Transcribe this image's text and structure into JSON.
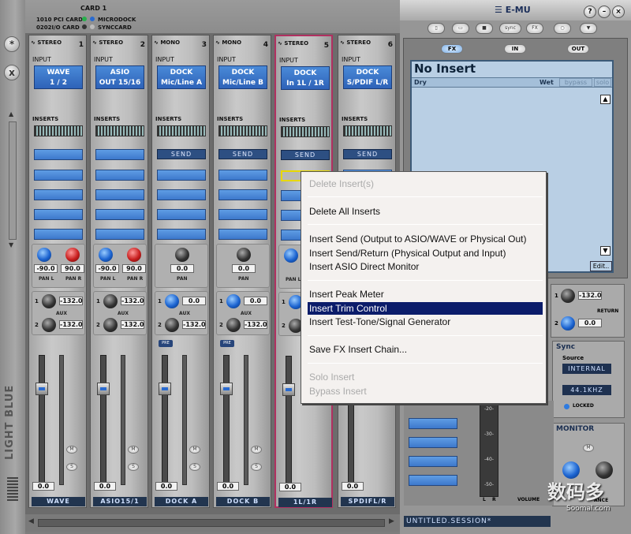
{
  "window": {
    "brand": "E-MU"
  },
  "card": {
    "title": "CARD 1",
    "line1": "1010 PCI CARD",
    "line2": "0202I/O CARD",
    "microdock": "MICRODOCK",
    "synccard": "SYNCCARD"
  },
  "sidebar": {
    "theme": "LIGHT BLUE",
    "btn1": "*",
    "btn2": "x"
  },
  "labels": {
    "input": "INPUT",
    "inserts": "INSERTS",
    "send": "SEND",
    "pan": "PAN",
    "pan_l": "PAN L",
    "pan_r": "PAN R",
    "aux": "AUX",
    "pre": "PRE",
    "m": "M",
    "s": "S"
  },
  "strips": [
    {
      "mode": "STEREO",
      "num": "1",
      "input": "WAVE\n1 / 2",
      "pan_l": "-90.0",
      "pan_r": "90.0",
      "aux1": "-132.0",
      "aux2": "-132.0",
      "fader": "0.0",
      "name": "WAVE"
    },
    {
      "mode": "STEREO",
      "num": "2",
      "input": "ASIO\nOUT 15/16",
      "pan_l": "-90.0",
      "pan_r": "90.0",
      "aux1": "-132.0",
      "aux2": "-132.0",
      "fader": "0.0",
      "name": "ASIO15/1"
    },
    {
      "mode": "MONO",
      "num": "3",
      "input": "DOCK\nMic/Line A",
      "pan": "0.0",
      "aux1": "0.0",
      "aux2": "-132.0",
      "fader": "0.0",
      "name": "DOCK A"
    },
    {
      "mode": "MONO",
      "num": "4",
      "input": "DOCK\nMic/Line B",
      "pan": "0.0",
      "aux1": "0.0",
      "aux2": "-132.0",
      "fader": "0.0",
      "name": "DOCK B"
    },
    {
      "mode": "STEREO",
      "num": "5",
      "input": "DOCK\nIn 1L / 1R",
      "fader": "0.0",
      "name": "1L/1R"
    },
    {
      "mode": "STEREO",
      "num": "6",
      "input": "DOCK\nS/PDIF L/R",
      "fader": "0.0",
      "name": "SPDIFL/R"
    }
  ],
  "toolbar": {
    "sync": "sync",
    "fx": "FX"
  },
  "fx_tabs": [
    "FX",
    "IN",
    "OUT"
  ],
  "fx_panel": {
    "title": "No Insert",
    "dry": "Dry",
    "wet": "Wet",
    "bypass": "bypass",
    "solo": "solo",
    "edit": "Edit.."
  },
  "context_menu": {
    "items": [
      {
        "label": "Delete Insert(s)",
        "enabled": false
      },
      {
        "label": "Delete All Inserts",
        "enabled": true
      },
      {
        "label": "Insert Send (Output to ASIO/WAVE or Physical Out)",
        "enabled": true
      },
      {
        "label": "Insert Send/Return (Physical Output and Input)",
        "enabled": true
      },
      {
        "label": "Insert ASIO Direct Monitor",
        "enabled": true
      },
      {
        "label": "Insert Peak Meter",
        "enabled": true
      },
      {
        "label": "Insert Trim Control",
        "enabled": true,
        "highlighted": true
      },
      {
        "label": "Insert Test-Tone/Signal Generator",
        "enabled": true
      },
      {
        "label": "Save FX Insert Chain...",
        "enabled": true
      },
      {
        "label": "Solo Insert",
        "enabled": false
      },
      {
        "label": "Bypass Insert",
        "enabled": false
      }
    ]
  },
  "aux_return": {
    "aux1": "-132.0",
    "aux2": "0.0",
    "label": "RETURN"
  },
  "sync": {
    "title": "Sync",
    "source": "Source",
    "internal": "INTERNAL",
    "rate": "44.1KHZ",
    "locked": "LOCKED"
  },
  "monitor": {
    "title": "MONITOR",
    "m": "M",
    "volume": "VOLUME",
    "balance": "ANCE"
  },
  "scale": [
    "-20-",
    "-30-",
    "-40-",
    "-50-"
  ],
  "lr": [
    "L",
    "R"
  ],
  "session": "UNTITLED.SESSION*",
  "watermark": {
    "cn": "数码多",
    "url": "Soomal.com"
  }
}
